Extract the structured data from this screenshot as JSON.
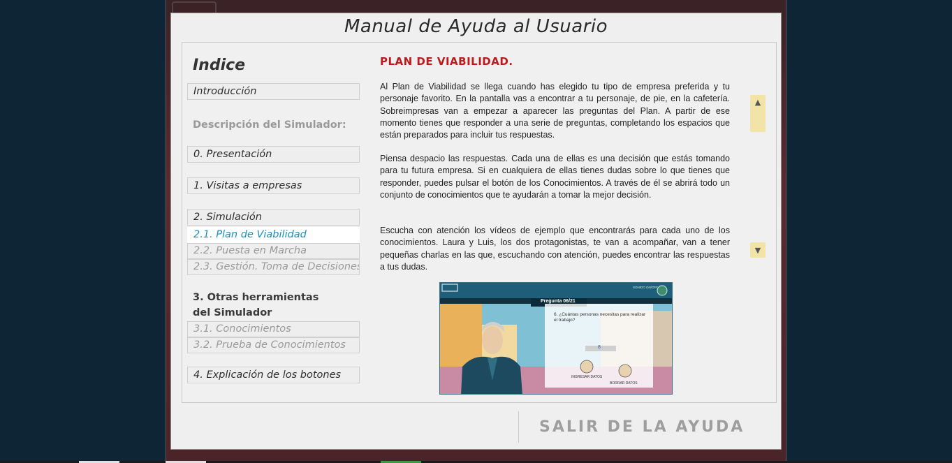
{
  "dialog": {
    "title": "Manual de Ayuda al Usuario",
    "exit_label": "SALIR DE LA AYUDA"
  },
  "index": {
    "title": "Indice",
    "intro": "Introducción",
    "section_description": "Descripción del Simulador:",
    "presentation": "0. Presentación",
    "visits": "1. Visitas a empresas",
    "simulation": "2. Simulación",
    "sim_items": [
      "2.1. Plan de Viabilidad",
      "2.2. Puesta en Marcha",
      "2.3. Gestión. Toma de Decisiones"
    ],
    "other_tools_line1": "3. Otras herramientas",
    "other_tools_line2": "del Simulador",
    "tool_items": [
      "3.1. Conocimientos",
      "3.2. Prueba de Conocimientos"
    ],
    "buttons": "4. Explicación de los botones",
    "active_item": "2.1. Plan de Viabilidad"
  },
  "content": {
    "heading": "PLAN DE VIABILIDAD.",
    "paragraphs": [
      "Al Plan de Viabilidad se llega cuando has elegido tu tipo de empresa preferida y tu personaje favorito. En la pantalla vas a encontrar a tu personaje, de pie, en la cafetería. Sobreimpresas van a empezar a aparecer las preguntas del Plan. A partir de ese momento tienes que responder a una serie de preguntas, completando los espacios que están preparados para incluir tus respuestas.",
      "Piensa despacio las respuestas. Cada una de ellas es una decisión que estás tomando para tu futura empresa. Si en cualquiera de ellas tienes dudas sobre lo que tienes que responder, puedes pulsar el botón de los Conocimientos. A través de él se abrirá todo un conjunto de conocimientos que te ayudarán a tomar la mejor decisión.",
      "Escucha con atención los vídeos de ejemplo que encontrarás para cada uno de los conocimientos. Laura y Luis, los dos protagonistas, te van a acompañar, van a tener pequeñas charlas en las que, escuchando con atención, puedes encontrar las respuestas a tus dudas."
    ],
    "screenshot": {
      "question_header": "Pregunta 06/21",
      "question_text": "6. ¿Cuántas personas necesitas para realizar el trabajo?",
      "answer_value": "8",
      "enter_label": "INGRESAR DATOS",
      "clear_label": "BORRAR DATOS",
      "sound_label": "SONIDO ON/OFF"
    }
  },
  "colors": {
    "heading": "#c0181c",
    "active_link": "#1a8fc0",
    "scroll_button": "#f2e3a6",
    "page_bg": "#0e2535"
  }
}
